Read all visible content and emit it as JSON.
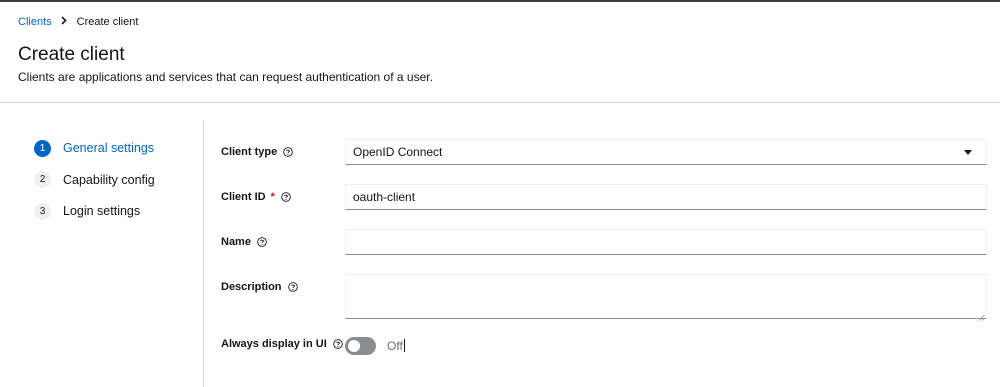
{
  "breadcrumb": {
    "parent": "Clients",
    "current": "Create client"
  },
  "header": {
    "title": "Create client",
    "subtitle": "Clients are applications and services that can request authentication of a user."
  },
  "wizard": {
    "steps": [
      {
        "num": "1",
        "label": "General settings",
        "active": true
      },
      {
        "num": "2",
        "label": "Capability config",
        "active": false
      },
      {
        "num": "3",
        "label": "Login settings",
        "active": false
      }
    ]
  },
  "form": {
    "client_type": {
      "label": "Client type",
      "value": "OpenID Connect",
      "icon": "help-icon"
    },
    "client_id": {
      "label": "Client ID",
      "required_mark": "*",
      "value": "oauth-client",
      "icon": "help-icon"
    },
    "name": {
      "label": "Name",
      "value": "",
      "icon": "help-icon"
    },
    "description": {
      "label": "Description",
      "value": "",
      "icon": "help-icon"
    },
    "always_display": {
      "label": "Always display in UI",
      "state": "Off",
      "enabled": false,
      "icon": "help-icon"
    }
  },
  "colors": {
    "accent": "#0066cc",
    "required": "#c9190b",
    "toggle_off": "#8a8d90"
  }
}
